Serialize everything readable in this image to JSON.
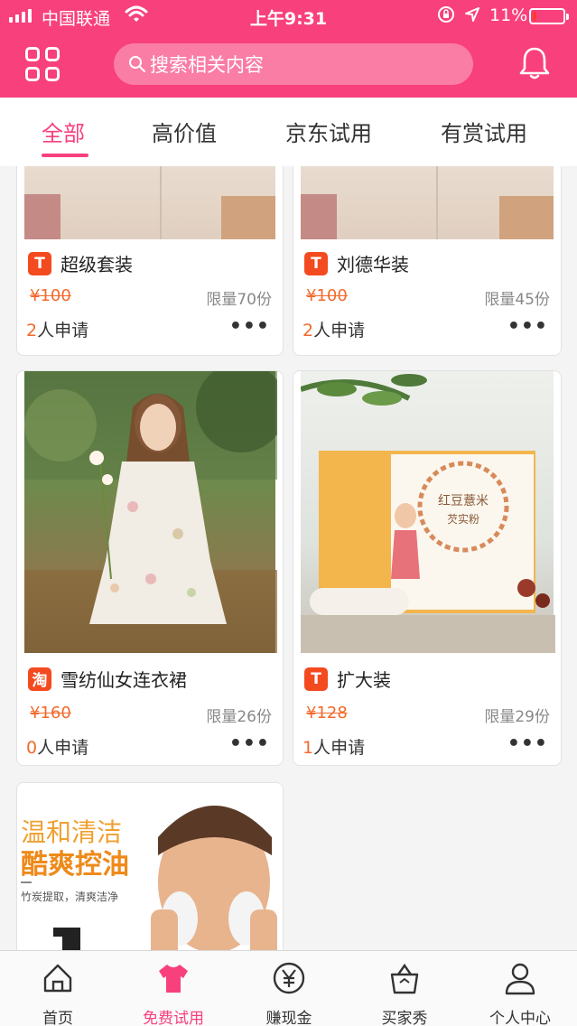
{
  "status_bar": {
    "carrier": "中国联通",
    "time": "上午9:31",
    "battery": "11%"
  },
  "header": {
    "search_placeholder": "搜索相关内容"
  },
  "tabs": [
    {
      "label": "全部",
      "active": true
    },
    {
      "label": "高价值",
      "active": false
    },
    {
      "label": "京东试用",
      "active": false
    },
    {
      "label": "有赏试用",
      "active": false
    }
  ],
  "products": [
    {
      "shop": "T",
      "shop_type": "tmall",
      "name": "超级套装",
      "price": "¥100",
      "limit": "限量70份",
      "applicants": "2",
      "apply_suffix": "人申请",
      "more": "•••"
    },
    {
      "shop": "T",
      "shop_type": "tmall",
      "name": "刘德华装",
      "price": "¥100",
      "limit": "限量45份",
      "applicants": "2",
      "apply_suffix": "人申请",
      "more": "•••"
    },
    {
      "shop": "淘",
      "shop_type": "taobao",
      "name": "雪纺仙女连衣裙",
      "price": "¥160",
      "limit": "限量26份",
      "applicants": "0",
      "apply_suffix": "人申请",
      "more": "•••"
    },
    {
      "shop": "T",
      "shop_type": "tmall",
      "name": "扩大装",
      "price": "¥128",
      "limit": "限量29份",
      "applicants": "1",
      "apply_suffix": "人申请",
      "more": "•••"
    }
  ],
  "banner": {
    "line1": "温和清洁",
    "line2": "酷爽控油",
    "line3": "竹炭提取，清爽洁净"
  },
  "package_text": {
    "title1": "红豆薏米",
    "title2": "芡实粉"
  },
  "bottom_nav": [
    {
      "label": "首页",
      "icon": "home-icon",
      "active": false
    },
    {
      "label": "免费试用",
      "icon": "shirt-icon",
      "active": true
    },
    {
      "label": "赚现金",
      "icon": "yuan-icon",
      "active": false
    },
    {
      "label": "买家秀",
      "icon": "bag-icon",
      "active": false
    },
    {
      "label": "个人中心",
      "icon": "person-icon",
      "active": false
    }
  ],
  "colors": {
    "brand": "#f8407c",
    "price": "#f26a2c",
    "tmall": "#f44a20"
  }
}
